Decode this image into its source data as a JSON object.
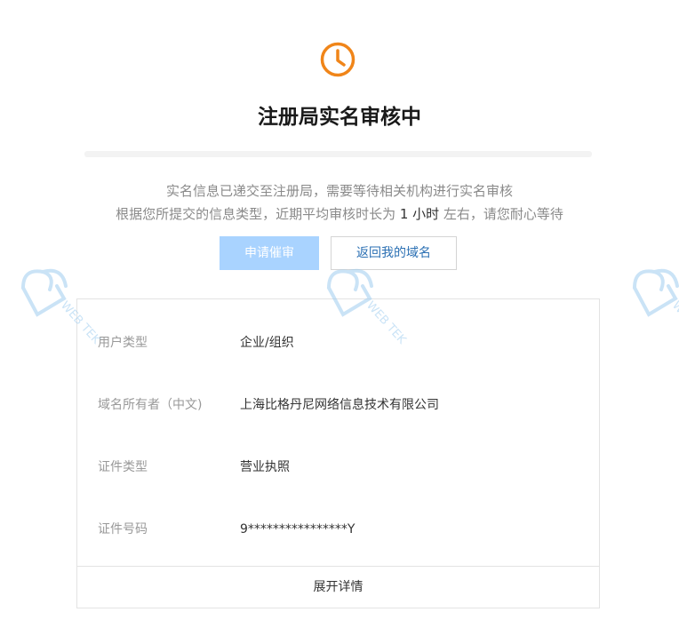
{
  "status": {
    "icon": "clock-icon",
    "title": "注册局实名审核中",
    "accent_color": "#f08519"
  },
  "description": {
    "line1": "实名信息已递交至注册局，需要等待相关机构进行实名审核",
    "line2_prefix": "根据您所提交的信息类型，近期平均审核时长为 ",
    "line2_highlight": "1 小时",
    "line2_suffix": " 左右，请您耐心等待"
  },
  "actions": {
    "urge_label": "申请催审",
    "back_label": "返回我的域名"
  },
  "info": {
    "rows": [
      {
        "label": "用户类型",
        "value": "企业/组织"
      },
      {
        "label": "域名所有者（中文)",
        "value": "上海比格丹尼网络信息技术有限公司"
      },
      {
        "label": "证件类型",
        "value": "营业执照"
      },
      {
        "label": "证件号码",
        "value": "9****************Y"
      }
    ],
    "expand_label": "展开详情"
  },
  "watermark": {
    "text": "WEB TEK",
    "color": "#9fcdf0"
  }
}
